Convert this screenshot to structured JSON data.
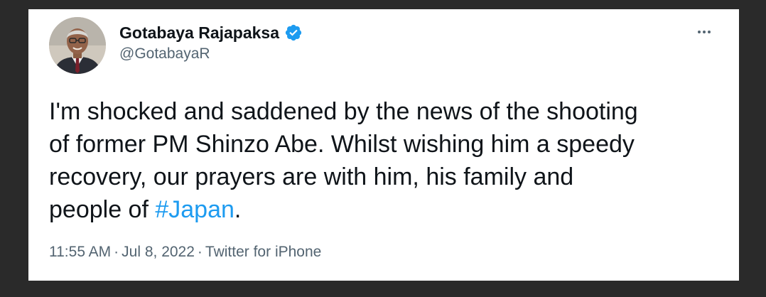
{
  "author": {
    "display_name": "Gotabaya Rajapaksa",
    "handle": "@GotabayaR",
    "verified": true,
    "verified_color": "#1d9bf0"
  },
  "menu": {
    "icon": "more-horizontal-icon"
  },
  "tweet": {
    "text_before_hashtag": "I'm shocked and saddened by the news of the shooting\nof former PM Shinzo Abe. Whilst wishing him a speedy\nrecovery, our prayers are with him, his family and\npeople of ",
    "hashtag": "#Japan",
    "text_after_hashtag": "."
  },
  "meta": {
    "time": "11:55 AM",
    "separator": "·",
    "date": "Jul 8, 2022",
    "source": "Twitter for iPhone"
  },
  "colors": {
    "link": "#1d9bf0",
    "text": "#0f1419",
    "secondary": "#536471"
  }
}
